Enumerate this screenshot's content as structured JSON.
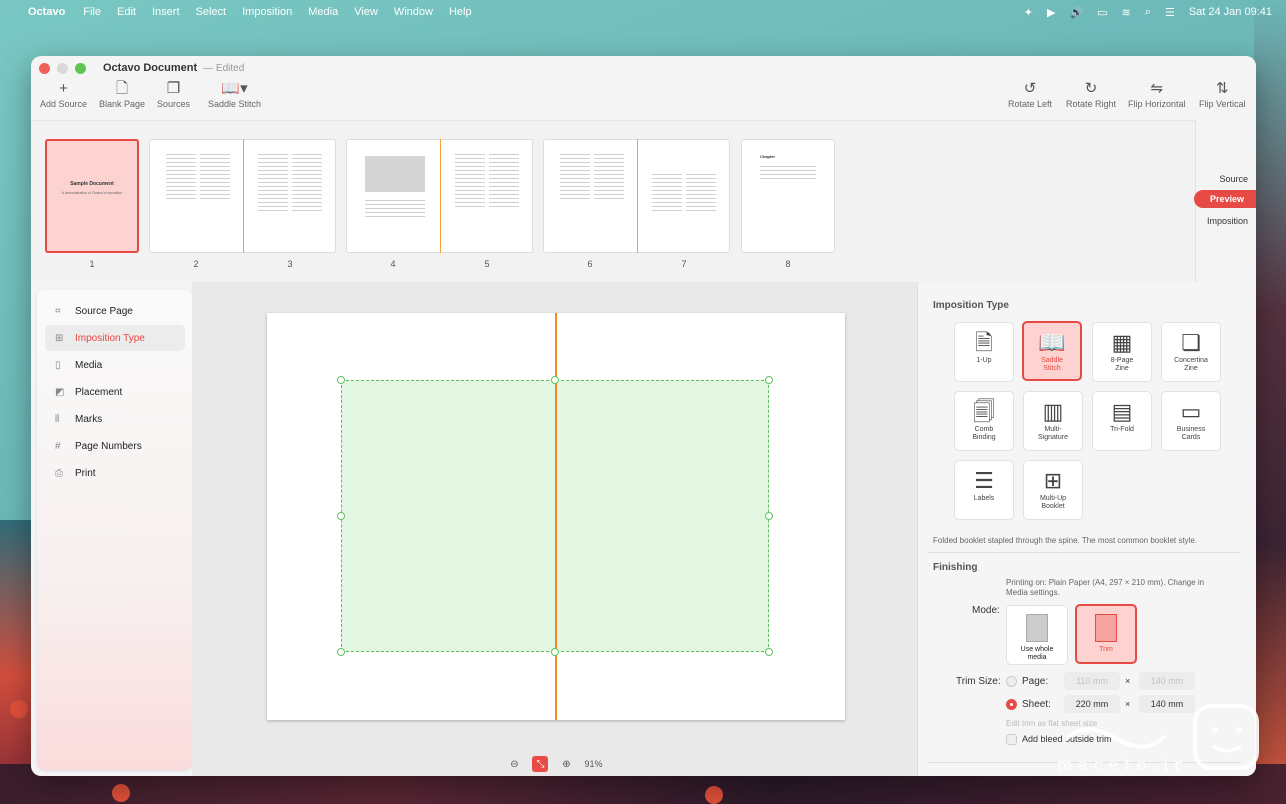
{
  "menubar": {
    "app": "Octavo",
    "items": [
      "File",
      "Edit",
      "Insert",
      "Select",
      "Imposition",
      "Media",
      "View",
      "Window",
      "Help"
    ],
    "datetime": "Sat 24 Jan 09:41"
  },
  "window": {
    "title": "Octavo Document",
    "subtitle": "Edited"
  },
  "toolbar": {
    "left": [
      {
        "label": "Add Source",
        "icon": "plus-icon"
      },
      {
        "label": "Blank Page",
        "icon": "blank-page-icon"
      },
      {
        "label": "Sources",
        "icon": "sources-icon"
      },
      {
        "label": "Saddle Stitch",
        "icon": "book-icon"
      }
    ],
    "right": [
      {
        "label": "Rotate Left",
        "icon": "rotate-left-icon"
      },
      {
        "label": "Rotate Right",
        "icon": "rotate-right-icon"
      },
      {
        "label": "Flip Horizontal",
        "icon": "flip-horizontal-icon"
      },
      {
        "label": "Flip Vertical",
        "icon": "flip-vertical-icon"
      }
    ]
  },
  "pages": [
    "1",
    "2",
    "3",
    "4",
    "5",
    "6",
    "7",
    "8"
  ],
  "thumbnail_cover": {
    "title": "Sample Document",
    "subtitle": "A demonstration of Octavo's imposition"
  },
  "thumbnail_chapter": "Chapter",
  "modes": {
    "source": "Source",
    "preview": "Preview",
    "imposition": "Imposition"
  },
  "sidebar": {
    "items": [
      {
        "label": "Source Page",
        "icon": "source-page-icon"
      },
      {
        "label": "Imposition Type",
        "icon": "imposition-type-icon"
      },
      {
        "label": "Media",
        "icon": "media-icon"
      },
      {
        "label": "Placement",
        "icon": "placement-icon"
      },
      {
        "label": "Marks",
        "icon": "marks-icon"
      },
      {
        "label": "Page Numbers",
        "icon": "page-numbers-icon"
      },
      {
        "label": "Print",
        "icon": "print-icon"
      }
    ]
  },
  "zoom": {
    "level": "91%"
  },
  "panel": {
    "imposition_title": "Imposition Type",
    "types": [
      {
        "label": "1-Up"
      },
      {
        "label": "Saddle Stitch",
        "selected": true
      },
      {
        "label": "8-Page Zine"
      },
      {
        "label": "Concertina Zine"
      },
      {
        "label": "Comb Binding"
      },
      {
        "label": "Multi-Signature"
      },
      {
        "label": "Tri-Fold"
      },
      {
        "label": "Business Cards"
      },
      {
        "label": "Labels"
      },
      {
        "label": "Multi-Up Booklet"
      }
    ],
    "description": "Folded booklet stapled through the spine. The most common booklet style.",
    "finishing_title": "Finishing",
    "printing_on": "Printing on: Plain Paper (A4, 297 × 210 mm). Change in Media settings.",
    "mode_label": "Mode:",
    "mode_options": [
      {
        "label": "Use whole media"
      },
      {
        "label": "Trim",
        "selected": true
      }
    ],
    "trim_size_label": "Trim Size:",
    "page_label": "Page:",
    "page_w": "110 mm",
    "page_h": "140 mm",
    "sheet_label": "Sheet:",
    "sheet_w": "220 mm",
    "sheet_h": "140 mm",
    "times": "×",
    "hint": "Edit trim as flat sheet size",
    "bleed_label": "Add bleed outside trim"
  },
  "accent": "#e64a44"
}
